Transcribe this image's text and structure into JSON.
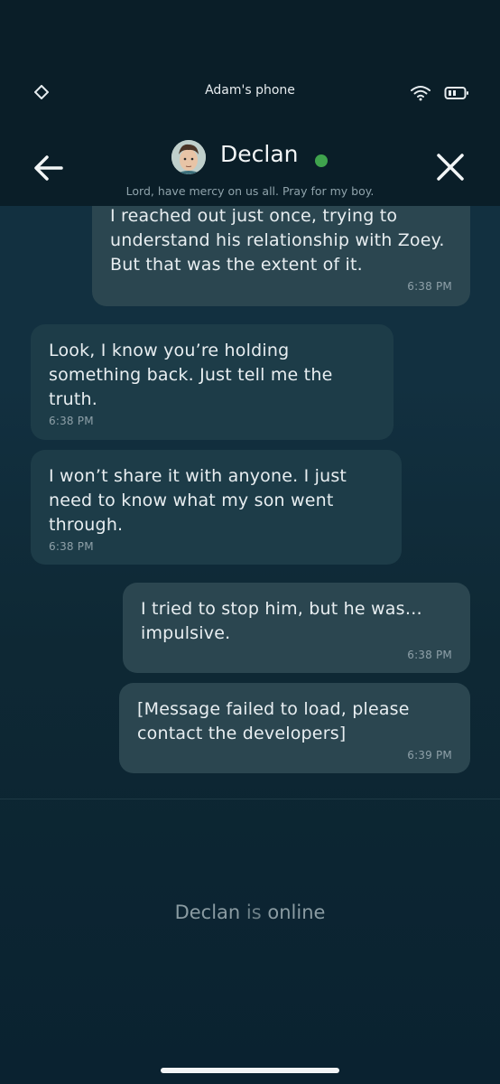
{
  "status_bar": {
    "device_name": "Adam's phone",
    "icons": [
      "diamond-icon",
      "wifi-icon",
      "battery-icon"
    ]
  },
  "header": {
    "back_icon": "arrow-left-icon",
    "close_icon": "close-icon",
    "contact_name": "Declan",
    "online": true,
    "status_line": "Lord, have mercy on us all. Pray for my boy."
  },
  "messages": [
    {
      "direction": "sent",
      "text": "I reached out just once, trying to understand his relationship with Zoey. But that was the extent of it.",
      "time": "6:38 PM"
    },
    {
      "direction": "received",
      "text": "Look, I know you’re holding something back. Just tell me the truth.",
      "time": "6:38 PM"
    },
    {
      "direction": "received",
      "text": "I won’t share it with anyone. I just need to know what my son went through.",
      "time": "6:38 PM"
    },
    {
      "direction": "sent",
      "text": "I tried to stop him, but he was… impulsive.",
      "time": "6:38 PM"
    },
    {
      "direction": "sent",
      "text": "[Message failed to load, please contact the developers]",
      "time": "6:39 PM"
    }
  ],
  "footer": {
    "name": "Declan",
    "word_is": "is",
    "state": "online"
  },
  "colors": {
    "background": "#0f2a36",
    "header": "#0a1e28",
    "sent_bubble": "#2b4650",
    "received_bubble": "#1d3c48",
    "online_dot": "#3fa34d"
  }
}
